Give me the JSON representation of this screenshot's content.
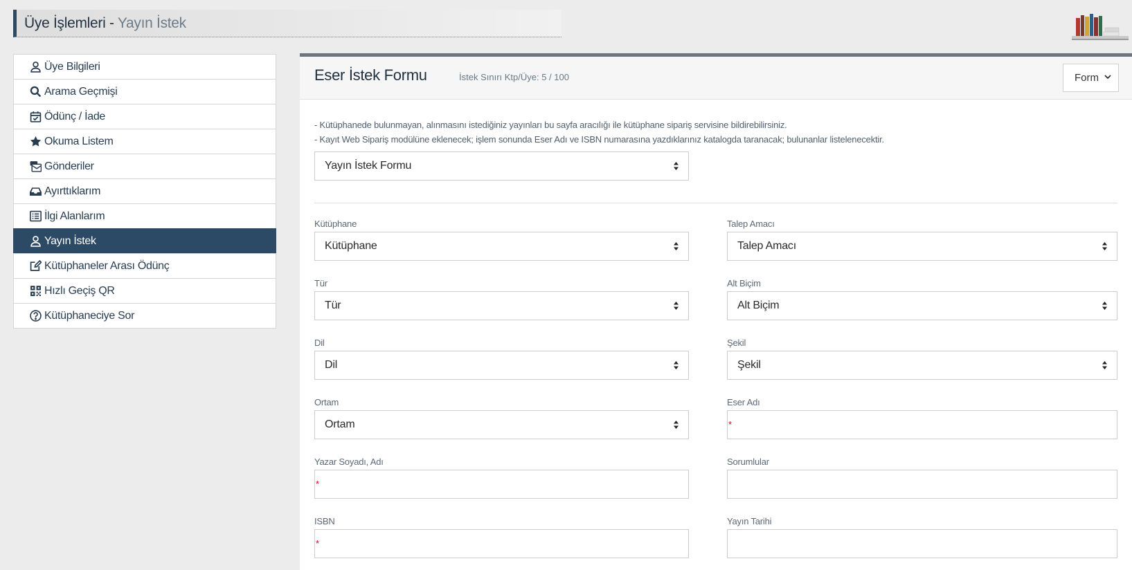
{
  "header": {
    "title": "Üye İşlemleri",
    "separator": " - ",
    "subtitle": "Yayın İstek",
    "shelf_icon": "bookshelf-icon"
  },
  "sidebar": {
    "items": [
      {
        "label": "Üye Bilgileri",
        "icon": "user-icon"
      },
      {
        "label": "Arama Geçmişi",
        "icon": "search-icon"
      },
      {
        "label": "Ödünç / İade",
        "icon": "calendar-check-icon"
      },
      {
        "label": "Okuma Listem",
        "icon": "star-icon"
      },
      {
        "label": "Gönderiler",
        "icon": "mail-bulk-icon"
      },
      {
        "label": "Ayırttıklarım",
        "icon": "inbox-icon"
      },
      {
        "label": "İlgi Alanlarım",
        "icon": "list-icon"
      },
      {
        "label": "Yayın İstek",
        "icon": "user-icon",
        "active": true
      },
      {
        "label": "Kütüphaneler Arası Ödünç",
        "icon": "edit-icon"
      },
      {
        "label": "Hızlı Geçiş QR",
        "icon": "qrcode-icon"
      },
      {
        "label": "Kütüphaneciye Sor",
        "icon": "question-circle-icon"
      }
    ]
  },
  "panel": {
    "title": "Eser İstek Formu",
    "limit": "İstek Sınırı Ktp/Üye: 5 / 100",
    "view_select": "Form",
    "info_lines": [
      "- Kütüphanede bulunmayan, alınmasını istediğiniz yayınları bu sayfa aracılığı ile kütüphane sipariş servisine bildirebilirsiniz.",
      "- Kayıt Web Sipariş modülüne eklenecek; işlem sonunda Eser Adı ve ISBN numarasına yazdıklarınız katalogda taranacak; bulunanlar listelenecektir."
    ],
    "form_type": "Yayın İstek Formu"
  },
  "form": {
    "kutuphane": {
      "label": "Kütüphane",
      "value": "Kütüphane"
    },
    "talep_amaci": {
      "label": "Talep Amacı",
      "value": "Talep Amacı"
    },
    "tur": {
      "label": "Tür",
      "value": "Tür"
    },
    "alt_bicim": {
      "label": "Alt Biçim",
      "value": "Alt Biçim"
    },
    "dil": {
      "label": "Dil",
      "value": "Dil"
    },
    "sekil": {
      "label": "Şekil",
      "value": "Şekil"
    },
    "ortam": {
      "label": "Ortam",
      "value": "Ortam"
    },
    "eser_adi": {
      "label": "Eser Adı",
      "required": "*"
    },
    "yazar": {
      "label": "Yazar Soyadı, Adı",
      "required": "*"
    },
    "sorumlular": {
      "label": "Sorumlular"
    },
    "isbn": {
      "label": "ISBN",
      "required": "*"
    },
    "yayin_tarihi": {
      "label": "Yayın Tarihi"
    }
  }
}
